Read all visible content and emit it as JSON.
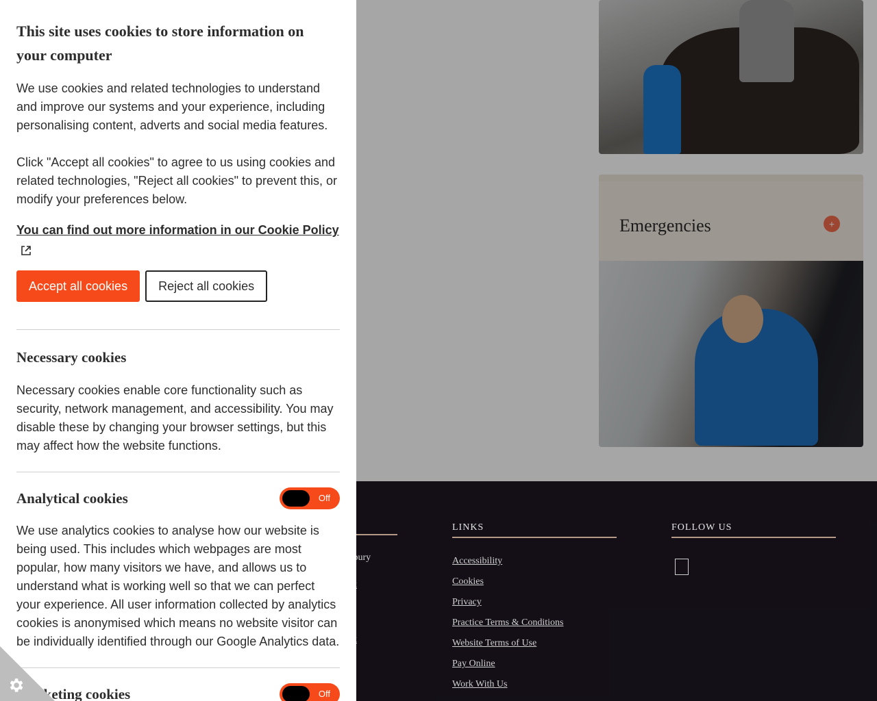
{
  "cookie_panel": {
    "title": "This site uses cookies to store information on your computer",
    "intro_1": "We use cookies and related technologies to understand and improve our systems and your experience, including personalising content, adverts and social media features.",
    "intro_2": "Click \"Accept all cookies\" to agree to us using cookies and related technologies, \"Reject all cookies\" to prevent this, or modify your preferences below.",
    "policy_link": "You can find out more information in our Cookie Policy",
    "accept_label": "Accept all cookies",
    "reject_label": "Reject all cookies",
    "necessary": {
      "title": "Necessary cookies",
      "text": "Necessary cookies enable core functionality such as security, network management, and accessibility. You may disable these by changing your browser settings, but this may affect how the website functions."
    },
    "analytical": {
      "title": "Analytical cookies",
      "toggle_state": "Off",
      "text": "We use analytics cookies to analyse how our website is being used. This includes which webpages are most popular, how many visitors we have, and allows us to understand what is working well so that we can perfect your experience. All user information collected by analytics cookies is anonymised which means no website visitor can be individually identified through our Google Analytics data."
    },
    "marketing": {
      "title": "Marketing cookies",
      "toggle_state": "Off"
    },
    "accent_color": "#f64a1a"
  },
  "page": {
    "emergencies_title": "Emergencies",
    "footer": {
      "left_items": [
        "spury",
        "ık",
        "ık"
      ],
      "links_heading": "LINKS",
      "links": [
        "Accessibility",
        "Cookies",
        "Privacy",
        "Practice Terms & Conditions",
        "Website Terms of Use",
        "Pay Online",
        "Work With Us"
      ],
      "follow_heading": "FOLLOW US"
    }
  },
  "icons": {
    "settings": "gear-icon",
    "external_link": "external-link-icon",
    "emergency": "plus-circle-icon"
  }
}
